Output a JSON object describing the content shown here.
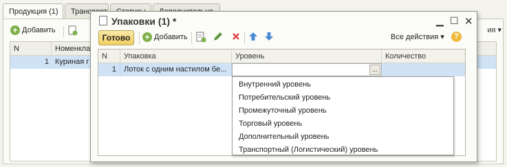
{
  "background": {
    "tabs": [
      {
        "label": "Продукция (1)",
        "active": true
      },
      {
        "label": "Транспорт",
        "active": false
      },
      {
        "label": "Статусы",
        "active": false
      },
      {
        "label": "Дополнительно",
        "active": false
      }
    ],
    "toolbar": {
      "add_label": "Добавить",
      "all_actions_label": "ия ▾"
    },
    "table": {
      "headers": [
        "N",
        "Номенклатура"
      ],
      "rows": [
        {
          "n": "1",
          "name": "Куриная г"
        }
      ]
    }
  },
  "dialog": {
    "title": "Упаковки (1) *",
    "toolbar": {
      "ready_label": "Готово",
      "add_label": "Добавить",
      "all_actions_label": "Все действия ▾",
      "help_label": "?"
    },
    "table": {
      "headers": {
        "n": "N",
        "packaging": "Упаковка",
        "level": "Уровень",
        "quantity": "Количество"
      },
      "rows": [
        {
          "n": "1",
          "packaging": "Лоток с одним настилом бе...",
          "level": "",
          "quantity": ""
        }
      ],
      "ellipsis_label": "..."
    },
    "level_dropdown": {
      "options": [
        "Внутренний уровень",
        "Потребительский уровень",
        "Промежуточный уровень",
        "Торговый уровень",
        "Дополнительный уровень",
        "Транспортный (Логистический) уровень"
      ]
    }
  },
  "colors": {
    "selected_row": "#cfe2f6",
    "ready_button": "#f1cf62",
    "add_icon": "#7fb04c",
    "delete_icon": "#e04848",
    "arrow_icon": "#4a8ad4"
  }
}
